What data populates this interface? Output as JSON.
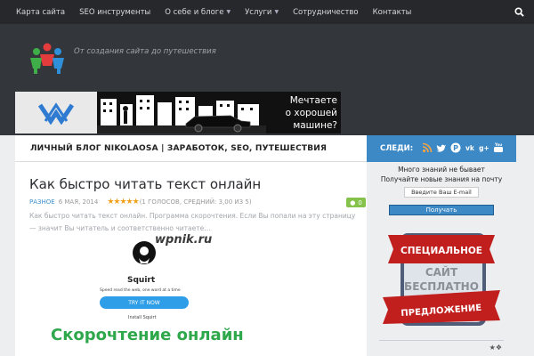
{
  "nav": {
    "items": [
      {
        "label": "Карта сайта",
        "has_caret": false
      },
      {
        "label": "SEO инструменты",
        "has_caret": false
      },
      {
        "label": "О себе и блоге",
        "has_caret": true
      },
      {
        "label": "Услуги",
        "has_caret": true
      },
      {
        "label": "Сотрудничество",
        "has_caret": false
      },
      {
        "label": "Контакты",
        "has_caret": false
      }
    ],
    "search_icon": "search-icon"
  },
  "header": {
    "tagline": "От создания сайта до путешествия",
    "banner_text_line1": "Мечтаете",
    "banner_text_line2": "о хорошей",
    "banner_text_line3": "машине?"
  },
  "blog": {
    "title": "ЛИЧНЫЙ БЛОГ NIKOLAOSA | ЗАРАБОТОК, SEO, ПУТЕШЕСТВИЯ"
  },
  "post": {
    "title": "Как быстро читать текст онлайн",
    "category": "РАЗНОЕ",
    "date": "6 МАЯ, 2014",
    "stars": "★★★★★",
    "votes_text": "(1 ГОЛОСОВ, СРЕДНИЙ: 3,00 ИЗ 5)",
    "comments": "0",
    "excerpt": "Как быстро читать текст онлайн. Программа скорочтения. Если Вы попали на эту страницу — значит Вы читатель и соответственно читаете…",
    "watermark": "wpnik.ru",
    "image": {
      "brand": "Squirt",
      "subtitle": "Speed read the web, one word at a time",
      "button": "TRY IT NOW",
      "install": "Install Squirt",
      "green_caption": "Скорочтение онлайн"
    }
  },
  "sidebar": {
    "follow_label": "СЛЕДИ:",
    "social_icons": [
      "rss-icon",
      "twitter-icon",
      "pinterest-icon",
      "vk-icon",
      "google-plus-icon",
      "youtube-icon"
    ],
    "sub_line1": "Много знаний не бывает",
    "sub_line2": "Получайте новые знания на почту",
    "email_placeholder": "Введите Ваш E-mail",
    "get_button": "Получать",
    "promo_top": "СПЕЦИАЛЬНОЕ",
    "promo_mid1": "САЙТ",
    "promo_mid2": "БЕСПЛАТНО",
    "promo_bottom": "ПРЕДЛОЖЕНИЕ"
  },
  "colors": {
    "accent": "#3c89c6",
    "nav_bg": "#26282c",
    "header_bg": "#33363b",
    "badge_green": "#84c24c"
  }
}
